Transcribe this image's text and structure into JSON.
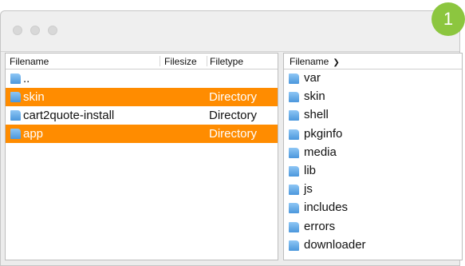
{
  "step_badge": "1",
  "left_pane": {
    "columns": {
      "filename": "Filename",
      "filesize": "Filesize",
      "filetype": "Filetype"
    },
    "rows": [
      {
        "name": "..",
        "type": "",
        "selected": false
      },
      {
        "name": "skin",
        "type": "Directory",
        "selected": true
      },
      {
        "name": "cart2quote-install",
        "type": "Directory",
        "selected": false
      },
      {
        "name": "app",
        "type": "Directory",
        "selected": true
      }
    ]
  },
  "right_pane": {
    "columns": {
      "filename": "Filename"
    },
    "sort_icon": "chevron-down-icon",
    "rows": [
      "var",
      "skin",
      "shell",
      "pkginfo",
      "media",
      "lib",
      "js",
      "includes",
      "errors",
      "downloader"
    ]
  },
  "colors": {
    "selection": "#ff8c00",
    "badge": "#8cc63f",
    "folder_icon": "#4b97dc"
  }
}
